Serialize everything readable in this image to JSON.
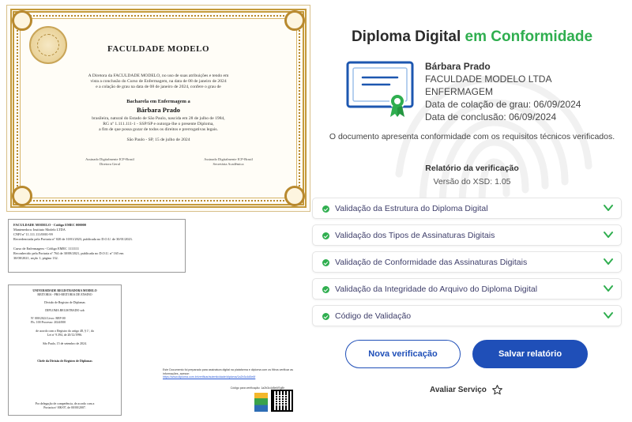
{
  "diploma": {
    "title": "FACULDADE MODELO",
    "intro_lines": [
      "A Diretora da FACULDADE MODELO, no uso de suas atribuições e tendo em",
      "vista a conclusão do Curso de Enfermagem, na data de 08 de janeiro de 2024",
      "e a colação de grau na data de 08 de janeiro de 2024, confere o grau de"
    ],
    "course": "Bacharela em Enfermagem a",
    "name": "Bárbara Prado",
    "bio_lines": [
      "brasileira, natural do Estado de São Paulo, nascida em 28 de julho de 1984,",
      "RG nº 1.111.111-1 - SSP/SP e outorga-lhe o presente Diploma,",
      "a fim de que possa gozar de todos os direitos e prerrogativas legais."
    ],
    "place_date": "São Paulo - SP, 15 de julho de 2024",
    "sig_left": [
      "Assinado Digitalmente ICP-Brasil",
      "Diretora Geral"
    ],
    "sig_right": [
      "Assinado Digitalmente ICP-Brasil",
      "Secretária Acadêmica"
    ]
  },
  "record": {
    "lines": [
      "FACULDADE MODELO - Código EMEC 000000",
      "Mantenedora: Instituto Modelo LTDA",
      "CNPJ nº 11.111.111/0001-99",
      "Recredenciada pela Portaria nº 020 de 10/01/2023, publicada no D.O.U. de 30/01/2023.",
      "",
      "Curso de Enfermagem - Código EMEC 1111111",
      "Reconhecido pela Portaria nº 764 de 30/08/2021, publicada no D.O.U. nº 165 em",
      "30/08/2021, seção 1, página 132."
    ]
  },
  "registry": {
    "lines": [
      "UNIVERSIDADE REGISTRADORA MODELO",
      "REITORIA - PRÓ-REITORIA DE ENSINO",
      "",
      "Divisão de Registro de Diplomas",
      "",
      "DIPLOMA REGISTRADO sob",
      "",
      "Nº 000/2024    Livro: REP-00",
      "Fls. 100       Processo: 2024/000",
      "",
      "de acordo com o Registro do artigo 48, § 1º, da",
      "Lei nº 9.394, de 20/12/1996.",
      "",
      "São Paulo, 15 de setembro de 2024.",
      "",
      "",
      "Chefe da Divisão de Registro de Diplomas",
      "",
      "",
      "",
      "",
      "Por delegação de competência, de acordo com a",
      "Portaria nº 000/07, de 00/00/2007."
    ]
  },
  "verification_note": {
    "text": "Este Documento foi preparado para assinatura digital na plataforma e diploma com os filtros verificar as informações, acesse:",
    "link": "https://www.diploma.com.br/verificar/autenticidade/diploma/1a2b3c4d5e6f",
    "code": "Código para verificação: 1a2b3c4d5e6f7g8h"
  },
  "panel": {
    "title_main": "Diploma Digital",
    "title_accent": "em Conformidade",
    "student_name": "Bárbara Prado",
    "institution_line1": "FACULDADE MODELO LTDA",
    "institution_line2": "ENFERMAGEM",
    "graduation_date": "Data de colação de grau: 06/09/2024",
    "completion_date": "Data de conclusão: 06/09/2024",
    "conformity_text": "O documento apresenta conformidade com os requisitos técnicos verificados.",
    "report_title": "Relatório da verificação",
    "xsd_version": "Versão do XSD: 1.05"
  },
  "validations": [
    {
      "label": "Validação da Estrutura do Diploma Digital"
    },
    {
      "label": "Validação dos Tipos de Assinaturas Digitais"
    },
    {
      "label": "Validação de Conformidade das Assinaturas Digitais"
    },
    {
      "label": "Validação da Integridade do Arquivo do Diploma Digital"
    },
    {
      "label": "Código de Validação"
    }
  ],
  "actions": {
    "new_verification": "Nova verificação",
    "save_report": "Salvar relatório",
    "rate_service": "Avaliar Serviço"
  },
  "colors": {
    "accent_green": "#2fae4f",
    "primary_blue": "#1f4fb8",
    "icon_blue": "#1d57b0",
    "gold_frame": "#c49a3c"
  },
  "icons": [
    "certificate-icon",
    "check-circle-icon",
    "chevron-down-icon",
    "star-icon",
    "fingerprint-watermark-icon",
    "qr-code-icon"
  ]
}
